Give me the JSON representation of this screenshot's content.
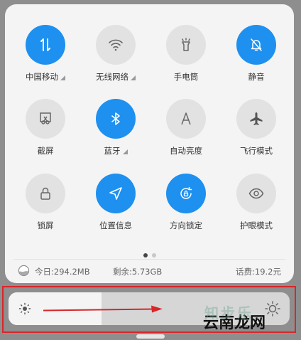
{
  "colors": {
    "accent": "#1e90f0",
    "tile_off": "#e2e2e2",
    "annotation": "#d8262a"
  },
  "tiles": [
    {
      "label": "中国移动",
      "icon": "mobile-data-icon",
      "on": true,
      "has_arrow": true
    },
    {
      "label": "无线网络",
      "icon": "wifi-icon",
      "on": false,
      "has_arrow": true
    },
    {
      "label": "手电筒",
      "icon": "flashlight-icon",
      "on": false,
      "has_arrow": false
    },
    {
      "label": "静音",
      "icon": "bell-off-icon",
      "on": true,
      "has_arrow": false
    },
    {
      "label": "截屏",
      "icon": "screenshot-icon",
      "on": false,
      "has_arrow": false
    },
    {
      "label": "蓝牙",
      "icon": "bluetooth-icon",
      "on": true,
      "has_arrow": true
    },
    {
      "label": "自动亮度",
      "icon": "auto-brightness-icon",
      "on": false,
      "has_arrow": false
    },
    {
      "label": "飞行模式",
      "icon": "airplane-icon",
      "on": false,
      "has_arrow": false
    },
    {
      "label": "锁屏",
      "icon": "lock-icon",
      "on": false,
      "has_arrow": false
    },
    {
      "label": "位置信息",
      "icon": "location-icon",
      "on": true,
      "has_arrow": false
    },
    {
      "label": "方向锁定",
      "icon": "rotation-lock-icon",
      "on": true,
      "has_arrow": false
    },
    {
      "label": "护眼模式",
      "icon": "eye-icon",
      "on": false,
      "has_arrow": false
    }
  ],
  "pager": {
    "pages": 2,
    "current": 1
  },
  "stats": {
    "today": "今日:294.2MB",
    "remaining": "剩余:5.73GB",
    "balance": "话费:19.2元"
  },
  "brightness": {
    "level": 0.33
  },
  "watermark": {
    "text": "云南龙网",
    "ghost": "知步乐"
  }
}
